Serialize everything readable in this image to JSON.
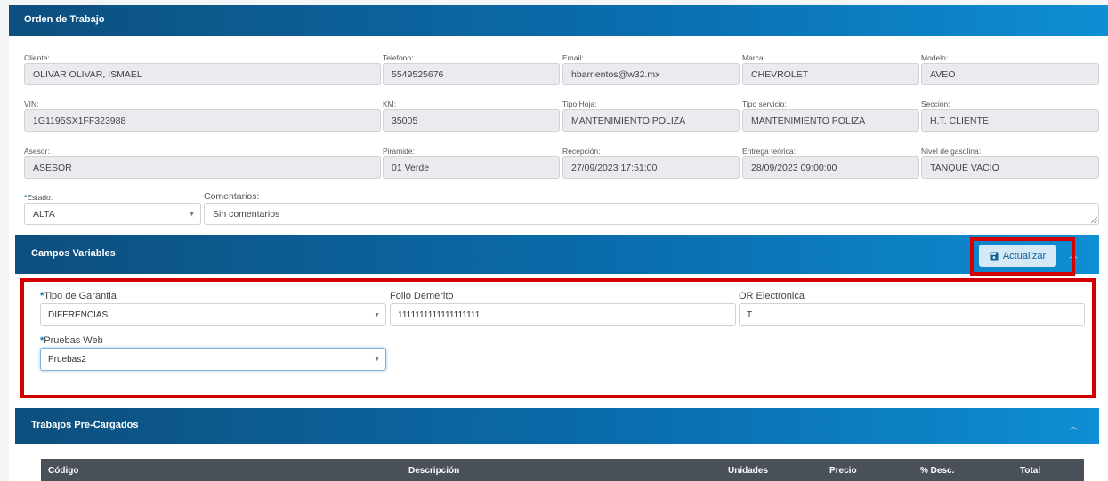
{
  "header": {
    "title": "Orden de Trabajo"
  },
  "fields": {
    "cliente": {
      "label": "Cliente:",
      "value": "OLIVAR OLIVAR, ISMAEL"
    },
    "telefono": {
      "label": "Telefono:",
      "value": "5549525676"
    },
    "email": {
      "label": "Email:",
      "value": "hbarrientos@w32.mx"
    },
    "marca": {
      "label": "Marca:",
      "value": "CHEVROLET"
    },
    "modelo": {
      "label": "Modelo:",
      "value": "AVEO"
    },
    "vin": {
      "label": "VIN:",
      "value": "1G1195SX1FF323988"
    },
    "km": {
      "label": "KM:",
      "value": "35005"
    },
    "tipo_hoja": {
      "label": "Tipo Hoja:",
      "value": "MANTENIMIENTO POLIZA"
    },
    "tipo_servicio": {
      "label": "Tipo servicio:",
      "value": "MANTENIMIENTO POLIZA"
    },
    "seccion": {
      "label": "Sección:",
      "value": "H.T. CLIENTE"
    },
    "asesor": {
      "label": "Asesor:",
      "value": "ASESOR"
    },
    "piramide": {
      "label": "Piramide:",
      "value": "01 Verde"
    },
    "recepcion": {
      "label": "Recepción:",
      "value": "27/09/2023 17:51:00"
    },
    "entrega": {
      "label": "Entrega teórica:",
      "value": "28/09/2023 09:00:00"
    },
    "gasolina": {
      "label": "Nivel de gasolina:",
      "value": "TANQUE VACIO"
    },
    "estado": {
      "required": "*",
      "label": "Estado:",
      "value": "ALTA"
    },
    "comentarios": {
      "label": "Comentarios:",
      "value": "Sin comentarios"
    }
  },
  "campos_variables": {
    "title": "Campos Variables",
    "update_button": "Actualizar",
    "tipo_garantia": {
      "required": "*",
      "label": "Tipo de Garantia",
      "value": "DIFERENCIAS"
    },
    "folio_demerito": {
      "label": "Folio Demerito",
      "value": "1111111111111111111"
    },
    "or_electronica": {
      "label": "OR Electronica",
      "value": "T"
    },
    "pruebas_web": {
      "required": "*",
      "label": "Pruebas Web",
      "value": "Pruebas2"
    }
  },
  "trabajos": {
    "title": "Trabajos Pre-Cargados",
    "columns": [
      "Código",
      "Descripción",
      "Unidades",
      "Precio",
      "% Desc.",
      "Total"
    ]
  },
  "icons": {
    "chevron": "chevron-up-icon",
    "save": "save-icon",
    "caret": "caret-down-icon"
  },
  "colors": {
    "header_start": "#0d4f7e",
    "header_end": "#0e8ed3",
    "highlight": "#d40000"
  }
}
